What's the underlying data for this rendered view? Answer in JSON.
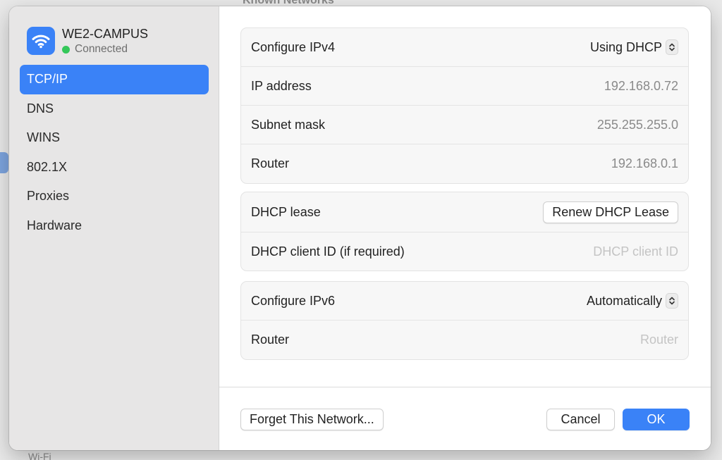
{
  "background": {
    "title": "Known Networks",
    "footer_text": "Wi-Fi"
  },
  "network": {
    "name": "WE2-CAMPUS",
    "status": "Connected",
    "status_color": "#34c759",
    "icon": "wifi-icon"
  },
  "sidebar": {
    "items": [
      {
        "label": "TCP/IP",
        "active": true
      },
      {
        "label": "DNS"
      },
      {
        "label": "WINS"
      },
      {
        "label": "802.1X"
      },
      {
        "label": "Proxies"
      },
      {
        "label": "Hardware"
      }
    ]
  },
  "ipv4": {
    "configure_label": "Configure IPv4",
    "configure_value": "Using DHCP",
    "ip_label": "IP address",
    "ip_value": "192.168.0.72",
    "subnet_label": "Subnet mask",
    "subnet_value": "255.255.255.0",
    "router_label": "Router",
    "router_value": "192.168.0.1"
  },
  "dhcp": {
    "lease_label": "DHCP lease",
    "renew_button": "Renew DHCP Lease",
    "client_id_label": "DHCP client ID (if required)",
    "client_id_placeholder": "DHCP client ID"
  },
  "ipv6": {
    "configure_label": "Configure IPv6",
    "configure_value": "Automatically",
    "router_label": "Router",
    "router_placeholder": "Router"
  },
  "footer": {
    "forget_button": "Forget This Network...",
    "cancel_button": "Cancel",
    "ok_button": "OK"
  },
  "colors": {
    "accent": "#3a82f7"
  }
}
